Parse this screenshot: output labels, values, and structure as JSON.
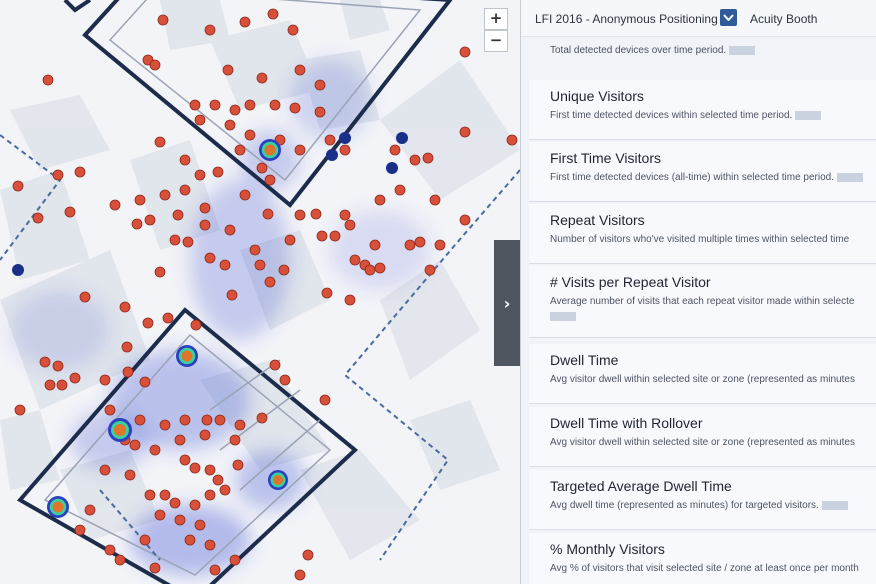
{
  "header": {
    "title": "LFI 2016 - Anonymous Positioning",
    "site": "Acuity Booth"
  },
  "map": {
    "zoom_in": "+",
    "zoom_out": "−",
    "toggle_icon": "›"
  },
  "panel": {
    "first_desc": "Total detected devices over time period.",
    "metrics": [
      {
        "title": "Unique Visitors",
        "desc": "First time detected devices within selected time period."
      },
      {
        "title": "First Time Visitors",
        "desc": "First time detected devices (all-time) within selected time period."
      },
      {
        "title": "Repeat Visitors",
        "desc": "Number of visitors who've visited multiple times within selected time"
      },
      {
        "title": "# Visits per Repeat Visitor",
        "desc": "Average number of visits that each repeat visitor made within selecte"
      },
      {
        "title": "Dwell Time",
        "desc": "Avg visitor dwell within selected site or zone (represented as minutes"
      },
      {
        "title": "Dwell Time with Rollover",
        "desc": "Avg visitor dwell within selected site or zone (represented as minutes"
      },
      {
        "title": "Targeted Average Dwell Time",
        "desc": "Avg dwell time (represented as minutes) for targeted visitors."
      },
      {
        "title": "% Monthly Visitors",
        "desc": "Avg % of visitors that visit selected site / zone at least once per month"
      }
    ]
  },
  "colors": {
    "accent": "#2f5b99",
    "device_dot": "#d9503a",
    "heat": "#3a4fd0",
    "outline": "#1c2c4a"
  }
}
